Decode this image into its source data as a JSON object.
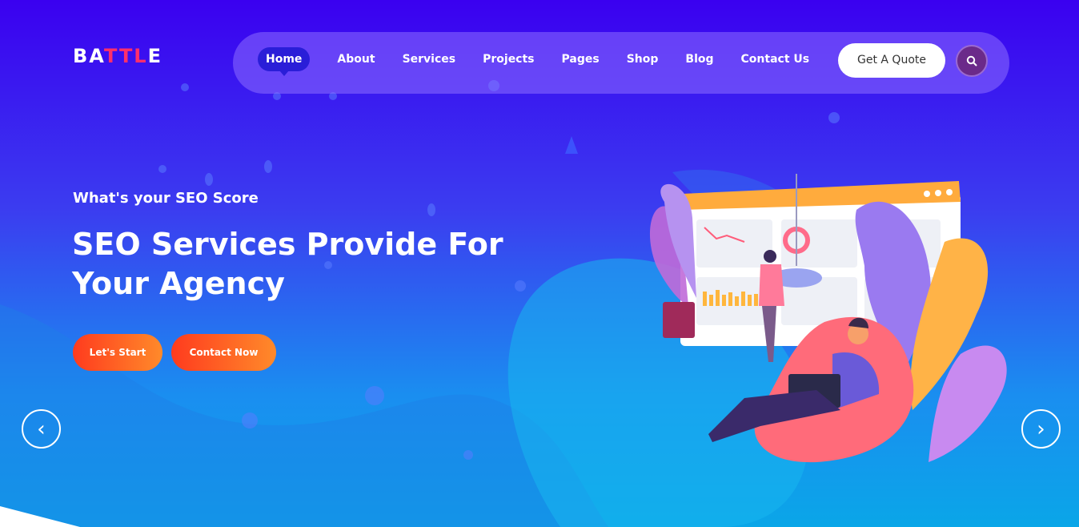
{
  "brand": {
    "logo_part1": "BA",
    "logo_part2": "TTL",
    "logo_part3": "E",
    "logo_colors": {
      "white": "#ffffff",
      "accent": "#ff2f6b"
    }
  },
  "nav": {
    "items": [
      {
        "label": "Home",
        "active": true
      },
      {
        "label": "About",
        "active": false
      },
      {
        "label": "Services",
        "active": false
      },
      {
        "label": "Projects",
        "active": false
      },
      {
        "label": "Pages",
        "active": false
      },
      {
        "label": "Shop",
        "active": false
      },
      {
        "label": "Blog",
        "active": false
      },
      {
        "label": "Contact Us",
        "active": false
      }
    ],
    "quote_label": "Get A Quote",
    "search_icon": "search-icon"
  },
  "hero": {
    "eyebrow": "What's your SEO Score",
    "headline_line1": "SEO Services Provide For",
    "headline_line2": "Your Agency",
    "cta_primary": "Let's Start",
    "cta_secondary": "Contact Now"
  },
  "slider": {
    "prev_icon": "chevron-left-icon",
    "next_icon": "chevron-right-icon",
    "prev_glyph": "‹",
    "next_glyph": "›"
  },
  "colors": {
    "bg_top": "#3a00f0",
    "bg_bottom": "#0aa6e8",
    "cta_gradient_start": "#ff3b1e",
    "cta_gradient_end": "#ff8a2a",
    "nav_active": "#2a1ed8",
    "search_button": "#6b2a8a"
  }
}
